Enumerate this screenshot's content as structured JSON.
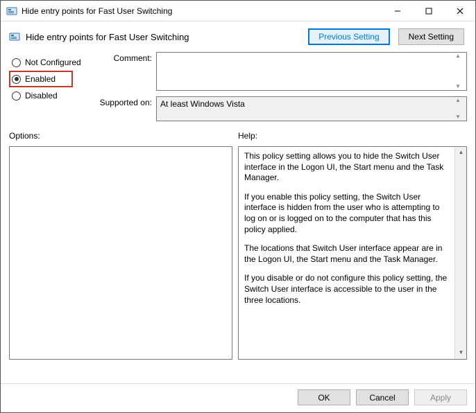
{
  "window": {
    "title": "Hide entry points for Fast User Switching",
    "icon": "policy-icon"
  },
  "header": {
    "subtitle": "Hide entry points for Fast User Switching",
    "previous_label": "Previous Setting",
    "next_label": "Next Setting"
  },
  "state": {
    "options": {
      "not_configured": "Not Configured",
      "enabled": "Enabled",
      "disabled": "Disabled"
    },
    "selected": "enabled"
  },
  "fields": {
    "comment_label": "Comment:",
    "comment_value": "",
    "supported_label": "Supported on:",
    "supported_value": "At least Windows Vista"
  },
  "panels": {
    "options_label": "Options:",
    "help_label": "Help:",
    "help_paragraphs": [
      "This policy setting allows you to hide the Switch User interface in the Logon UI, the Start menu and the Task Manager.",
      "If you enable this policy setting, the Switch User interface is hidden from the user who is attempting to log on or is logged on to the computer that has this policy applied.",
      "The locations that Switch User interface appear are in the Logon UI, the Start menu and the Task Manager.",
      "If you disable or do not configure this policy setting, the Switch User interface is accessible to the user in the three locations."
    ]
  },
  "footer": {
    "ok": "OK",
    "cancel": "Cancel",
    "apply": "Apply"
  }
}
